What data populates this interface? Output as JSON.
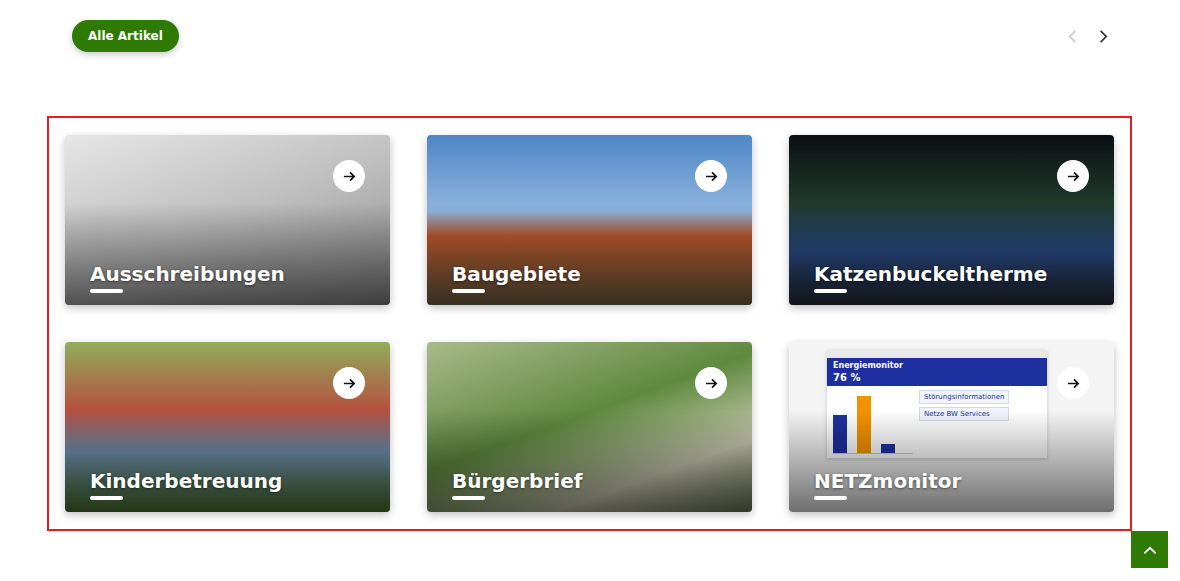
{
  "header": {
    "button": "Alle Artikel"
  },
  "pager": {
    "prev_disabled": true,
    "next_disabled": false
  },
  "cards": [
    {
      "title": "Ausschreibungen",
      "kind": "photo"
    },
    {
      "title": "Baugebiete",
      "kind": "photo"
    },
    {
      "title": "Katzenbuckeltherme",
      "kind": "photo"
    },
    {
      "title": "Kinderbetreuung",
      "kind": "photo"
    },
    {
      "title": "Bürgerbrief",
      "kind": "photo"
    },
    {
      "title": "NETZmonitor",
      "kind": "screenshot"
    }
  ],
  "netzmonitor_preview": {
    "title": "Energiemonitor",
    "percent": "76 %",
    "panels": [
      "Störungsinformationen",
      "Netze BW Services"
    ],
    "bars": [
      {
        "level": 0.6,
        "color": "#1d2f9e"
      },
      {
        "level": 0.9,
        "color": "#f39200"
      },
      {
        "level": 0.15,
        "color": "#1d2f9e"
      }
    ]
  }
}
